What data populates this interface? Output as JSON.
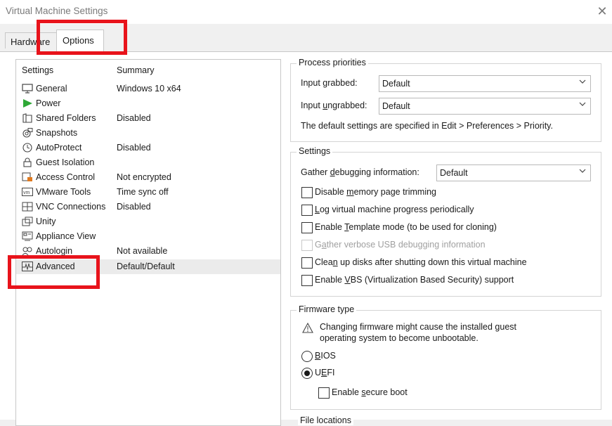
{
  "window": {
    "title": "Virtual Machine Settings",
    "close_glyph": "✕"
  },
  "tabs": [
    {
      "label": "Hardware",
      "active": false
    },
    {
      "label": "Options",
      "active": true
    }
  ],
  "settings_list": {
    "col_settings": "Settings",
    "col_summary": "Summary",
    "items": [
      {
        "label": "General",
        "summary": "Windows 10 x64",
        "icon": "monitor-icon"
      },
      {
        "label": "Power",
        "summary": "",
        "icon": "play-icon"
      },
      {
        "label": "Shared Folders",
        "summary": "Disabled",
        "icon": "folder-icon"
      },
      {
        "label": "Snapshots",
        "summary": "",
        "icon": "snapshot-icon"
      },
      {
        "label": "AutoProtect",
        "summary": "Disabled",
        "icon": "clock-icon"
      },
      {
        "label": "Guest Isolation",
        "summary": "",
        "icon": "lock-icon"
      },
      {
        "label": "Access Control",
        "summary": "Not encrypted",
        "icon": "access-control-icon"
      },
      {
        "label": "VMware Tools",
        "summary": "Time sync off",
        "icon": "vmware-tools-icon"
      },
      {
        "label": "VNC Connections",
        "summary": "Disabled",
        "icon": "vnc-icon"
      },
      {
        "label": "Unity",
        "summary": "",
        "icon": "unity-icon"
      },
      {
        "label": "Appliance View",
        "summary": "",
        "icon": "appliance-view-icon"
      },
      {
        "label": "Autologin",
        "summary": "Not available",
        "icon": "autologin-icon"
      },
      {
        "label": "Advanced",
        "summary": "Default/Default",
        "icon": "advanced-pulse-icon",
        "selected": true
      }
    ]
  },
  "process_priorities": {
    "title": "Process priorities",
    "input_grabbed_pre": "Input ",
    "input_grabbed_u": "g",
    "input_grabbed_post": "rabbed:",
    "input_grabbed_value": "Default",
    "input_ungrabbed_pre": "Input ",
    "input_ungrabbed_u": "u",
    "input_ungrabbed_post": "ngrabbed:",
    "input_ungrabbed_value": "Default",
    "note": "The default settings are specified in Edit > Preferences > Priority."
  },
  "settings_group": {
    "title": "Settings",
    "gather_pre": "Gather ",
    "gather_u": "d",
    "gather_post": "ebugging information:",
    "gather_value": "Default",
    "options": [
      {
        "pre": "Disable ",
        "u": "m",
        "post": "emory page trimming",
        "checked": false,
        "disabled": false
      },
      {
        "pre": "",
        "u": "L",
        "post": "og virtual machine progress periodically",
        "checked": false,
        "disabled": false
      },
      {
        "pre": "Enable ",
        "u": "T",
        "post": "emplate mode (to be used for cloning)",
        "checked": false,
        "disabled": false
      },
      {
        "pre": "G",
        "u": "a",
        "post": "ther verbose USB debugging information",
        "checked": false,
        "disabled": true
      },
      {
        "pre": "Clea",
        "u": "n",
        "post": " up disks after shutting down this virtual machine",
        "checked": false,
        "disabled": false
      },
      {
        "pre": "Enable ",
        "u": "V",
        "post": "BS (Virtualization Based Security) support",
        "checked": false,
        "disabled": false
      }
    ]
  },
  "firmware": {
    "title": "Firmware type",
    "warning_line1": "Changing firmware might cause the installed guest",
    "warning_line2": "operating system to become unbootable.",
    "bios_u": "B",
    "bios_post": "IOS",
    "uefi_pre": "U",
    "uefi_u": "E",
    "uefi_post": "FI",
    "selected": "UEFI",
    "secure_boot_pre": "Enable ",
    "secure_boot_u": "s",
    "secure_boot_post": "ecure boot",
    "secure_boot_checked": false
  },
  "next_group_title": "File locations",
  "highlight_color": "#e8131b"
}
